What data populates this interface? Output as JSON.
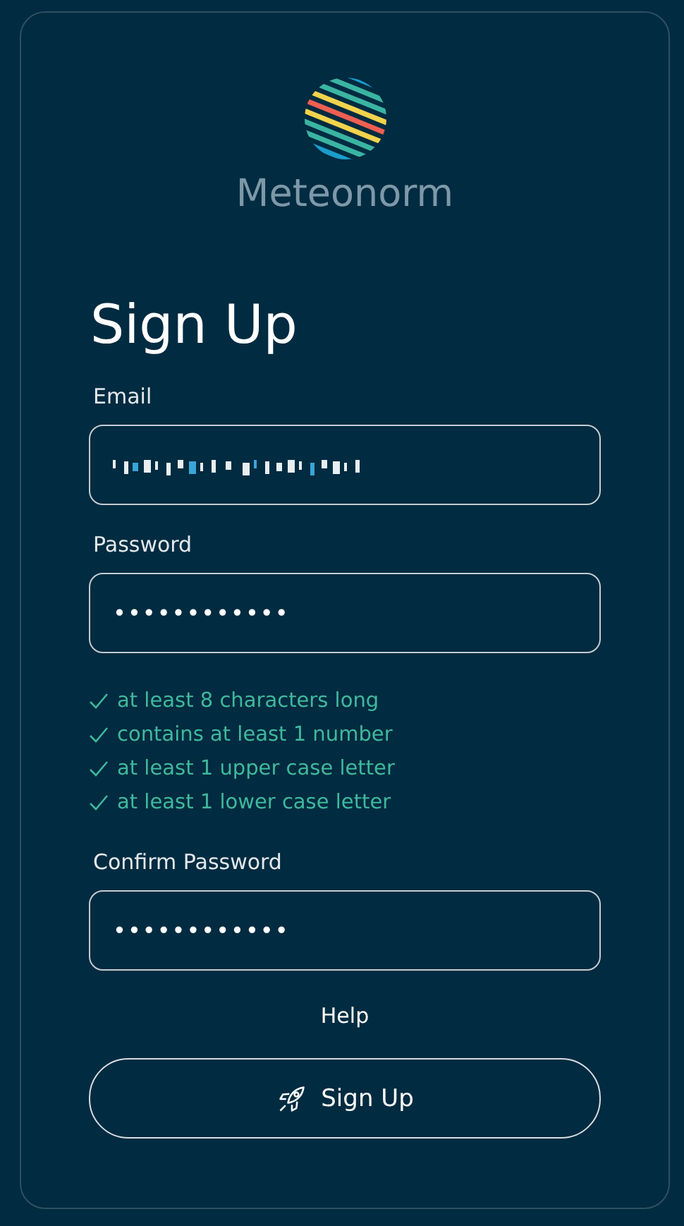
{
  "brand": {
    "name": "Meteonorm"
  },
  "title": "Sign Up",
  "fields": [
    {
      "label": "Email",
      "obscured": true
    },
    {
      "label": "Password",
      "obscured": false,
      "value": "••••••••••••"
    }
  ],
  "requirements": [
    {
      "text": "at least 8 characters long",
      "met": true
    },
    {
      "text": "contains at least 1 number",
      "met": true
    },
    {
      "text": "at least 1 upper case letter",
      "met": true
    },
    {
      "text": "at least 1 lower case letter",
      "met": true
    }
  ],
  "confirm_field": {
    "label": "Confirm Password",
    "value": "••••••••••••"
  },
  "help_link": "Help",
  "submit_button": "Sign Up"
}
